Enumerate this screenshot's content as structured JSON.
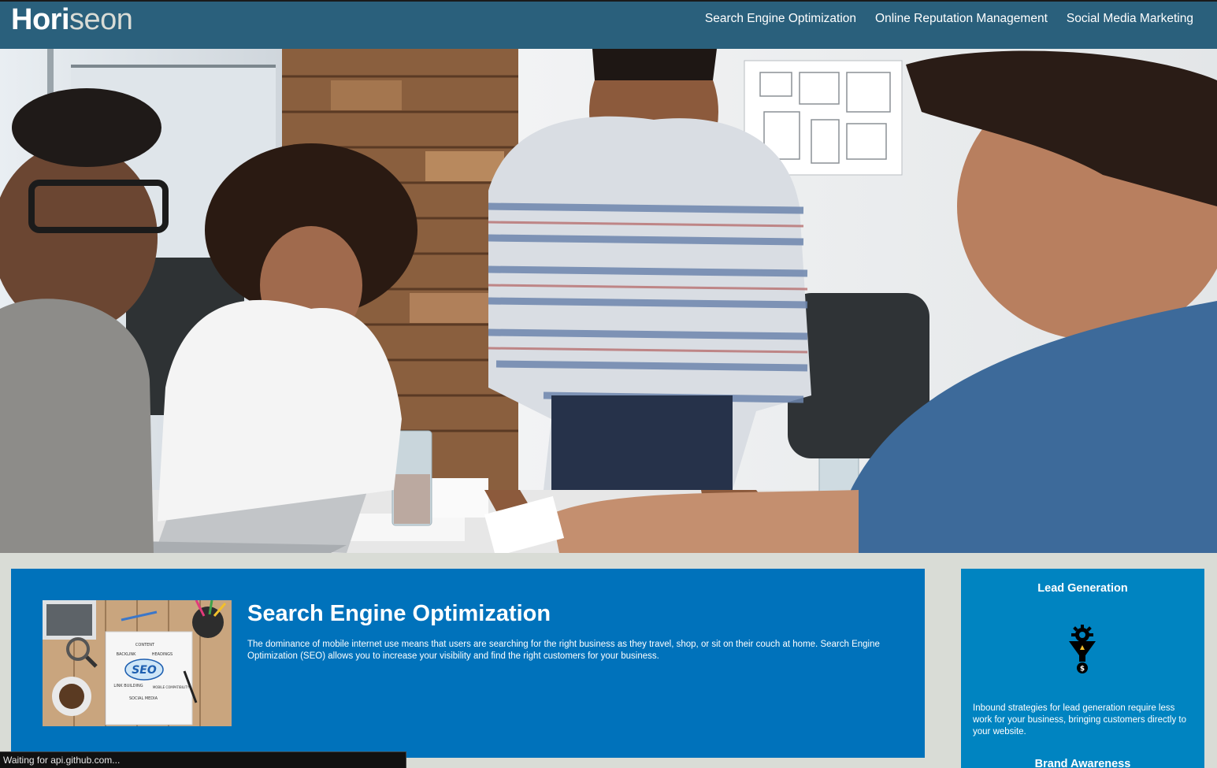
{
  "header": {
    "logo_main": "Hori",
    "logo_accent": "seon",
    "nav": [
      {
        "label": "Search Engine Optimization"
      },
      {
        "label": "Online Reputation Management"
      },
      {
        "label": "Social Media Marketing"
      }
    ]
  },
  "hero": {
    "image": "team-meeting-photo"
  },
  "content": {
    "image_words": {
      "center": "SEO",
      "around": [
        "CONTENT",
        "BACKLINK",
        "HEADINGS",
        "LINK BUILDING",
        "MOBILE COMPATIBILITY",
        "SOCIAL MEDIA"
      ]
    },
    "title": "Search Engine Optimization",
    "body": "The dominance of mobile internet use means that users are searching for the right business as they travel, shop, or sit on their couch at home. Search Engine Optimization (SEO) allows you to increase your visibility and find the right customers for your business."
  },
  "benefits": {
    "lead_title": "Lead Generation",
    "lead_icon": "lead-funnel-icon",
    "lead_body": "Inbound strategies for lead generation require less work for your business, bringing customers directly to your website.",
    "brand_title": "Brand Awareness"
  },
  "status_bar": {
    "text": "Waiting for api.github.com..."
  },
  "colors": {
    "header_bg": "#2a607c",
    "page_bg": "#d9dcd6",
    "content_bg": "#0072bb",
    "benefit_bg": "#0084c1"
  }
}
